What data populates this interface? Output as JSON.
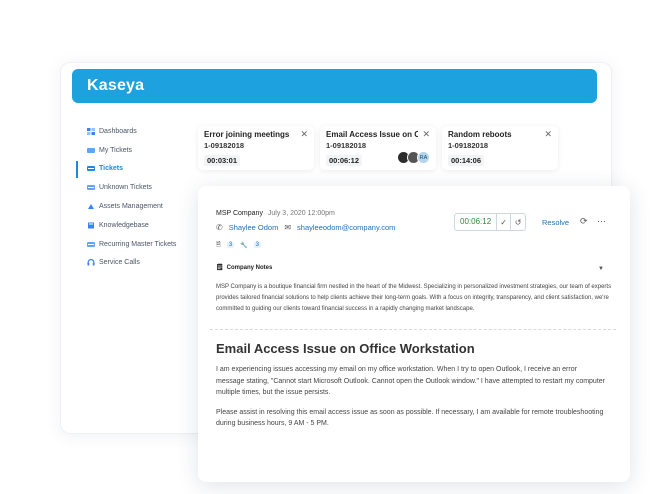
{
  "app": {
    "logo": "Kaseya"
  },
  "sidebar": {
    "items": [
      {
        "label": "Dashboards",
        "icon": "grid-icon",
        "active": false
      },
      {
        "label": "My Tickets",
        "icon": "ticket-icon",
        "active": false
      },
      {
        "label": "Tickets",
        "icon": "tickets-icon",
        "active": true
      },
      {
        "label": "Unknown Tickets",
        "icon": "unknown-ticket-icon",
        "active": false
      },
      {
        "label": "Assets Management",
        "icon": "assets-icon",
        "active": false
      },
      {
        "label": "Knowledgebase",
        "icon": "book-icon",
        "active": false
      },
      {
        "label": "Recurring Master Tickets",
        "icon": "recurring-icon",
        "active": false
      },
      {
        "label": "Service Calls",
        "icon": "headset-icon",
        "active": false
      }
    ]
  },
  "tabs": [
    {
      "title": "Error joining meetings",
      "id": "1-09182018",
      "timer": "00:03:01"
    },
    {
      "title": "Email Access Issue on O...",
      "id": "1-09182018",
      "timer": "00:06:12",
      "avatars": [
        "",
        "",
        "RA"
      ]
    },
    {
      "title": "Random reboots",
      "id": "1-09182018",
      "timer": "00:14:06"
    }
  ],
  "detail": {
    "company": "MSP Company",
    "date": "July 3, 2020 12:00pm",
    "contact_name": "Shaylee Odom",
    "contact_email": "shayleeodom@company.com",
    "attachments_count": "3",
    "tasks_count": "3",
    "timer": "00:06:12",
    "resolve_label": "Resolve",
    "notes_label": "Company Notes",
    "notes_text": "MSP Company is a boutique financial firm nestled in the heart of the Midwest. Specializing in personalized investment strategies, our team of experts provides tailored financial solutions to help clients achieve their long-term goals. With a focus on integrity, transparency, and client satisfaction, we're committed to guiding our clients toward financial success in a rapidly changing market landscape.",
    "issue_title": "Email Access Issue on Office Workstation",
    "issue_p1": "I am experiencing issues accessing my email on my office workstation. When I try to open Outlook, I receive an error message stating, \"Cannot start Microsoft Outlook. Cannot open the Outlook window.\" I have attempted to restart my computer multiple times, but the issue persists.",
    "issue_p2": "Please assist in resolving this email access issue as soon as possible. If necessary, I am available for remote troubleshooting during business hours, 9 AM - 5 PM."
  },
  "colors": {
    "brand": "#1da1df",
    "link": "#1e6fb8",
    "timer_green": "#2e8b3b"
  }
}
